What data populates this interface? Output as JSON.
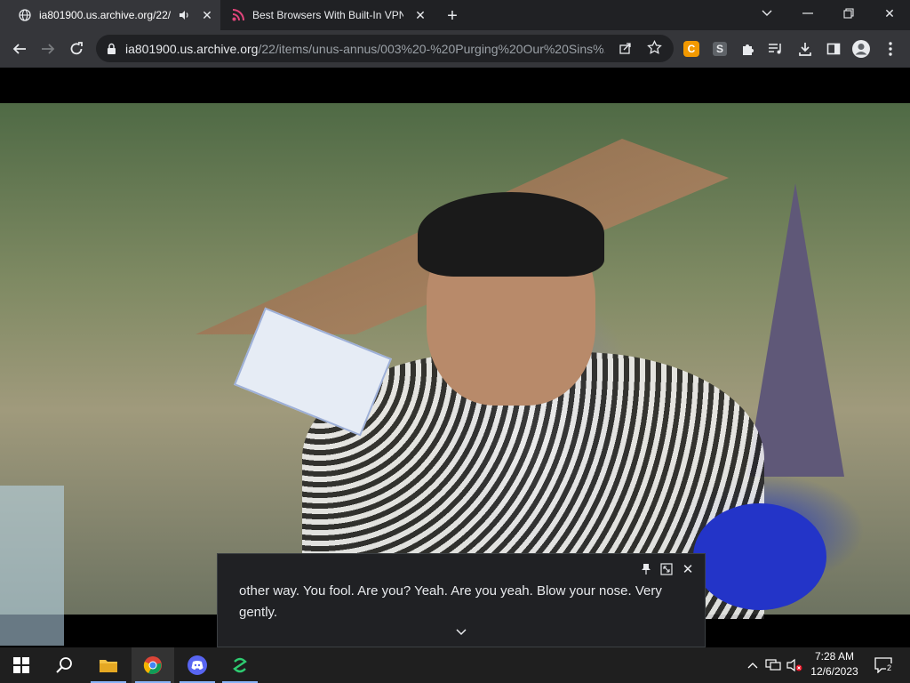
{
  "tabs": [
    {
      "title": "ia801900.us.archive.org/22/",
      "active": true
    },
    {
      "title": "Best Browsers With Built-In VPN",
      "active": false
    }
  ],
  "toolbar": {
    "url_host": "ia801900.us.archive.org",
    "url_path": "/22/items/unus-annus/003%20-%20Purging%20Our%20Sins%..."
  },
  "extensions": {
    "badge1": "C",
    "badge2": "S"
  },
  "caption": {
    "text": "other way. You fool. Are you? Yeah. Are you yeah. Blow your nose. Very gently."
  },
  "taskbar": {
    "time": "7:28 AM",
    "date": "12/6/2023",
    "notification_count": "2"
  },
  "colors": {
    "tabstrip_bg": "#202124",
    "toolbar_bg": "#35363a",
    "extension_orange": "#f29900",
    "discord_blue": "#5865f2"
  }
}
